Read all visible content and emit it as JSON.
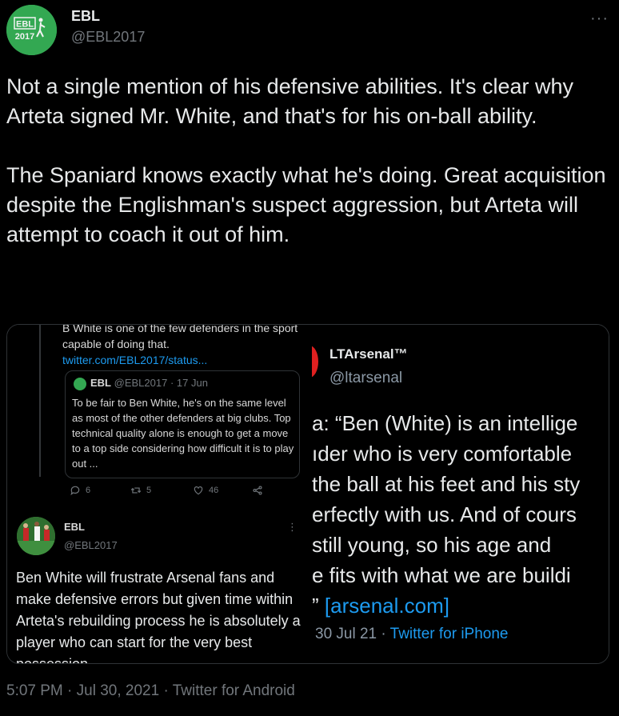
{
  "author": {
    "name": "EBL",
    "handle": "@EBL2017",
    "avatar_text": "EBL 2017"
  },
  "more_label": "···",
  "tweet": {
    "paragraph1": "Not a single mention of his defensive abilities. It's clear why Arteta signed Mr. White, and that's for his on-ball ability.",
    "paragraph2": "The Spaniard knows exactly what he's doing. Great acquisition despite the Englishman's suspect aggression, but Arteta will attempt to coach it out of him."
  },
  "media_left": {
    "top_text": "B White is one of the few defenders in the sport capable of doing that.",
    "top_link": "twitter.com/EBL2017/status...",
    "quote": {
      "name": "EBL",
      "handle": "@EBL2017",
      "date": "· 17 Jun",
      "text": "To be fair to Ben White, he's on the same level as most of the other defenders at big clubs. Top technical quality alone is enough to get a move to a top side considering how difficult it is to play out ..."
    },
    "actions": {
      "replies": "6",
      "retweets": "5",
      "likes": "46"
    },
    "reply": {
      "name": "EBL",
      "handle": "@EBL2017",
      "text": "Ben White will frustrate Arsenal fans and make defensive errors but given time within Arteta's rebuilding process he is absolutely a player who can start for the very best possession"
    }
  },
  "media_right": {
    "name": "LTArsenal™",
    "handle": "@ltarsenal",
    "lines": [
      "a: “Ben (White) is an intellige",
      "ıder who is very comfortable",
      "the ball at his feet and his sty",
      "erfectly with us. And of cours",
      "still young, so his age and",
      "e fits with what we are buildi",
      "” "
    ],
    "link": "[arsenal.com]",
    "date": "30 Jul 21 · ",
    "source": "Twitter for iPhone"
  },
  "timestamp": "5:07 PM · Jul 30, 2021 · Twitter for Android"
}
